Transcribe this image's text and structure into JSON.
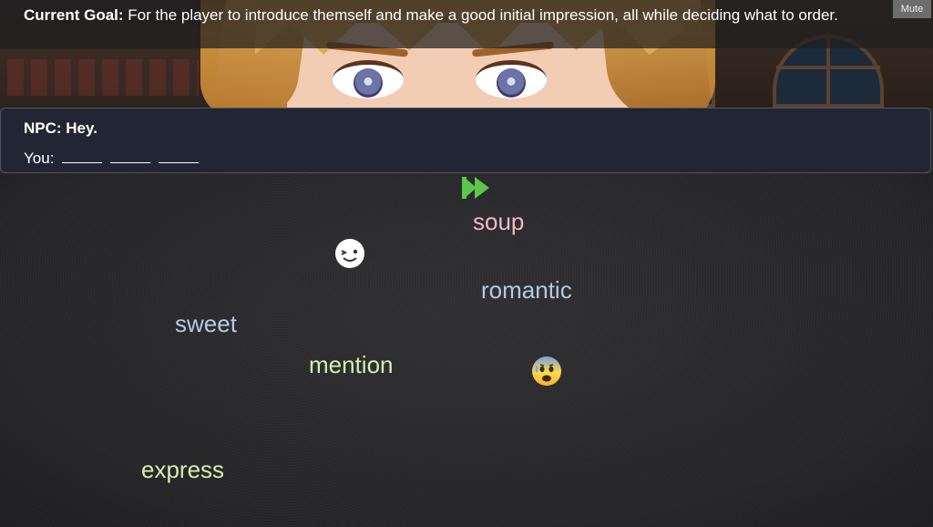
{
  "goal": {
    "label": "Current Goal:",
    "text": "For the player to introduce themself and make a good initial impression, all while deciding what to order."
  },
  "mute_button": "Mute",
  "dialog": {
    "npc_line": "NPC: Hey.",
    "you_label": "You:"
  },
  "words": [
    {
      "text": "soup",
      "color": "#f2b8c6"
    },
    {
      "text": "romantic",
      "color": "#b8c7e6"
    },
    {
      "text": "sweet",
      "color": "#b8c7e6"
    },
    {
      "text": "mention",
      "color": "#d6ecb0"
    },
    {
      "text": "express",
      "color": "#d6ecb0"
    }
  ],
  "icons": [
    "skip-forward-icon",
    "winking-face-icon",
    "anxious-sweat-face-icon"
  ],
  "colors": {
    "skip_green": "#5cc64d",
    "panel": "#222634"
  }
}
